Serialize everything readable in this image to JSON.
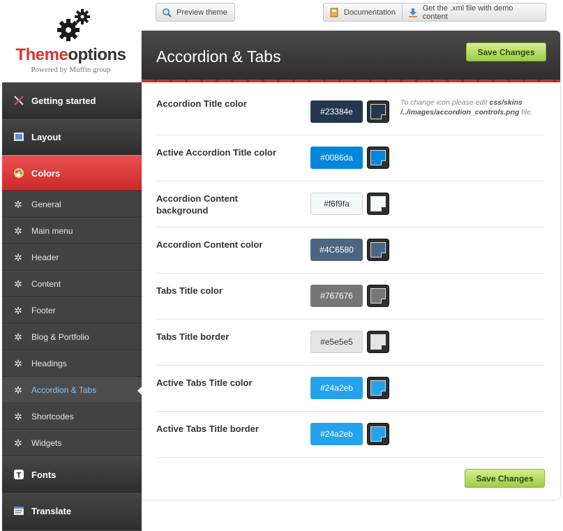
{
  "logo": {
    "brand_part1": "Theme",
    "brand_part2": "options",
    "powered": "Powered by Muffin group"
  },
  "toolbar": {
    "preview_label": "Preview theme",
    "documentation_label": "Documentation",
    "xml_label": "Get the .xml file with demo content"
  },
  "sidebar": {
    "main_items": [
      {
        "label": "Getting started",
        "icon": "tools-icon"
      },
      {
        "label": "Layout",
        "icon": "layout-icon"
      },
      {
        "label": "Colors",
        "icon": "palette-icon",
        "active": true
      },
      {
        "label": "Fonts",
        "icon": "font-icon"
      },
      {
        "label": "Translate",
        "icon": "translate-icon"
      }
    ],
    "sub_items": [
      {
        "label": "General"
      },
      {
        "label": "Main menu"
      },
      {
        "label": "Header"
      },
      {
        "label": "Content"
      },
      {
        "label": "Footer"
      },
      {
        "label": "Blog & Portfolio"
      },
      {
        "label": "Headings"
      },
      {
        "label": "Accordion & Tabs",
        "active": true
      },
      {
        "label": "Shortcodes"
      },
      {
        "label": "Widgets"
      }
    ]
  },
  "panel": {
    "title": "Accordion & Tabs",
    "save_label": "Save Changes",
    "note_prefix": "To change icon please edit ",
    "note_path": "css/skins /../images/accordion_controls.png",
    "note_suffix": " file.",
    "rows": [
      {
        "label": "Accordion Title color",
        "value": "#23384e",
        "color": "#23384e"
      },
      {
        "label": "Active Accordion Title color",
        "value": "#0086da",
        "color": "#0086da"
      },
      {
        "label": "Accordion Content background",
        "value": "#f6f9fa",
        "color": "#f6f9fa"
      },
      {
        "label": "Accordion Content color",
        "value": "#4C6580",
        "color": "#4C6580"
      },
      {
        "label": "Tabs Title color",
        "value": "#767676",
        "color": "#767676"
      },
      {
        "label": "Tabs Title border",
        "value": "#e5e5e5",
        "color": "#e5e5e5"
      },
      {
        "label": "Active Tabs Title color",
        "value": "#24a2eb",
        "color": "#24a2eb"
      },
      {
        "label": "Active Tabs Title border",
        "value": "#24a2eb",
        "color": "#24a2eb"
      }
    ]
  },
  "colors": {
    "accent_red": "#d83535",
    "sidebar_bg": "#3a3a3a",
    "save_green": "#9ccb4a"
  }
}
